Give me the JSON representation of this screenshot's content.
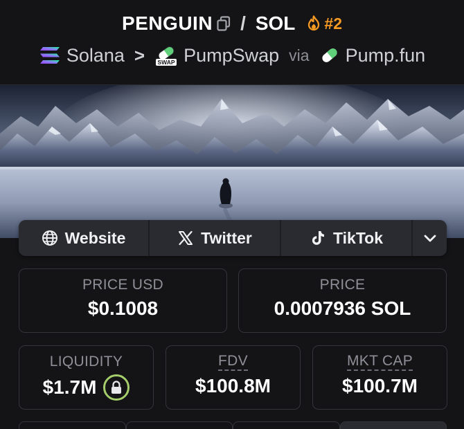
{
  "header": {
    "token_symbol": "PENGUIN",
    "separator": "/",
    "quote_symbol": "SOL",
    "rank": "#2",
    "chain_name": "Solana",
    "chevron": ">",
    "dex_name": "PumpSwap",
    "via_label": "via",
    "launchpad_name": "Pump.fun",
    "swap_icon_label": "SWAP"
  },
  "links": {
    "website_label": "Website",
    "twitter_label": "Twitter",
    "tiktok_label": "TikTok"
  },
  "stats": {
    "price_usd_label": "PRICE USD",
    "price_usd_value": "$0.1008",
    "price_label": "PRICE",
    "price_value": "0.0007936 SOL",
    "liquidity_label": "LIQUIDITY",
    "liquidity_value": "$1.7M",
    "fdv_label": "FDV",
    "fdv_value": "$100.8M",
    "mktcap_label": "MKT CAP",
    "mktcap_value": "$100.7M"
  },
  "colors": {
    "background": "#141417",
    "rank_orange": "#f59a22",
    "liquidity_lock_green": "#a5cf6a",
    "button_bg": "#2a2b31"
  },
  "icons": {
    "copy": "copy-icon",
    "rank": "flame-icon",
    "chain": "solana-logo-icon",
    "dex": "pumpswap-pill-icon",
    "launchpad": "pill-icon",
    "website": "globe-icon",
    "twitter": "x-logo-icon",
    "tiktok": "tiktok-icon",
    "more": "chevron-down-icon",
    "liquidity": "lock-icon"
  }
}
